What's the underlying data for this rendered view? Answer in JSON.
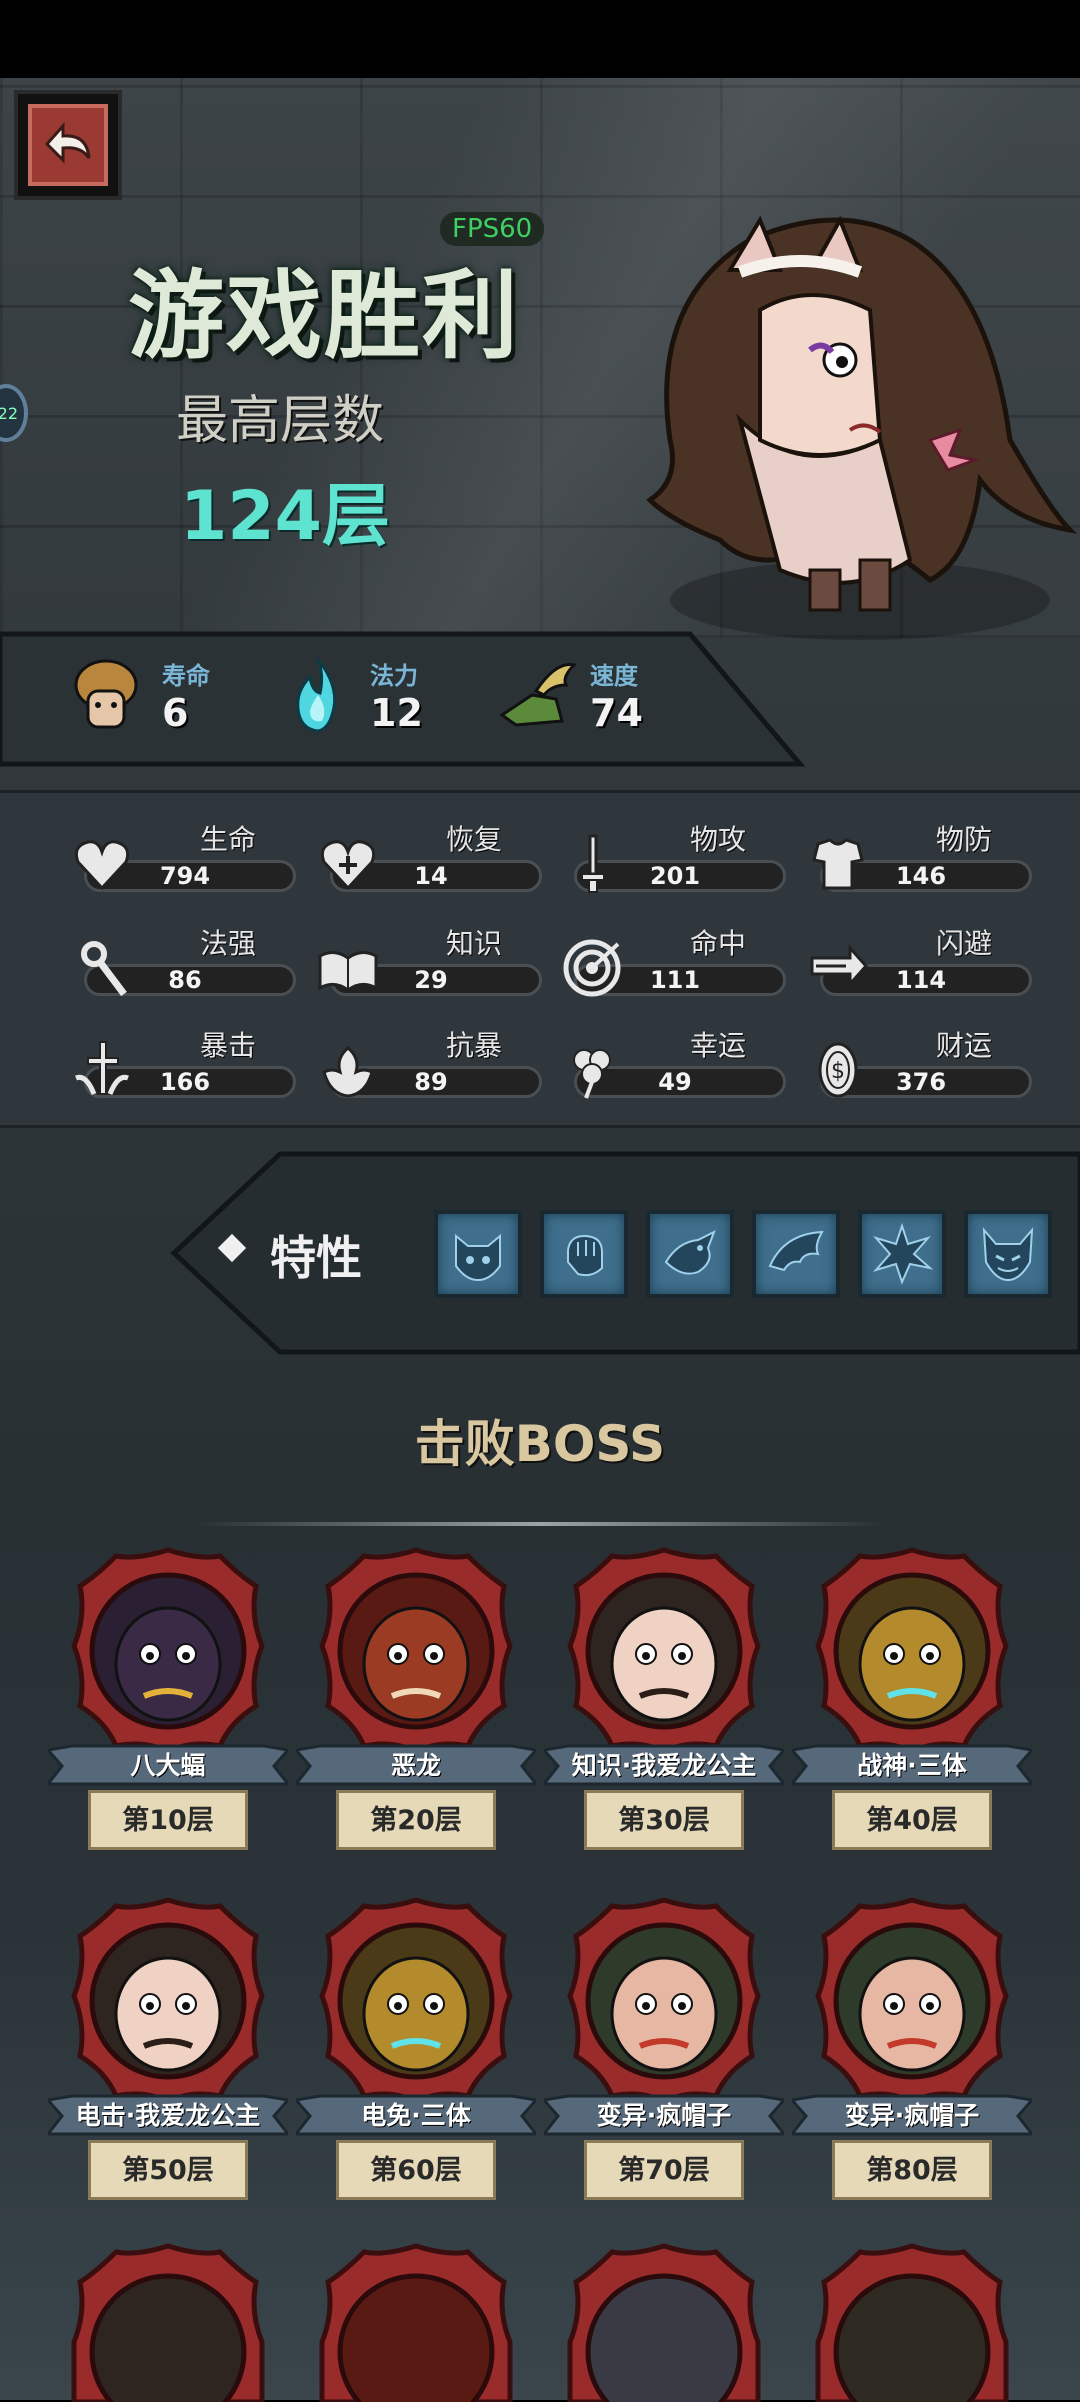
{
  "header": {
    "fps": "FPS60",
    "title": "游戏胜利",
    "max_floor_label": "最高层数",
    "max_floor_value": "124层",
    "side_badge": "22"
  },
  "top_stats": [
    {
      "label": "寿命",
      "value": "6",
      "icon": "mushroom-head-icon"
    },
    {
      "label": "法力",
      "value": "12",
      "icon": "blue-flame-icon"
    },
    {
      "label": "速度",
      "value": "74",
      "icon": "winged-boot-icon"
    }
  ],
  "attributes": [
    {
      "label": "生命",
      "value": "794",
      "icon": "heart-icon"
    },
    {
      "label": "恢复",
      "value": "14",
      "icon": "heal-heart-icon"
    },
    {
      "label": "物攻",
      "value": "201",
      "icon": "sword-icon"
    },
    {
      "label": "物防",
      "value": "146",
      "icon": "armor-icon"
    },
    {
      "label": "法强",
      "value": "86",
      "icon": "magic-staff-icon"
    },
    {
      "label": "知识",
      "value": "29",
      "icon": "book-icon"
    },
    {
      "label": "命中",
      "value": "111",
      "icon": "target-icon"
    },
    {
      "label": "闪避",
      "value": "114",
      "icon": "dodge-arrow-icon"
    },
    {
      "label": "暴击",
      "value": "166",
      "icon": "critical-icon"
    },
    {
      "label": "抗暴",
      "value": "89",
      "icon": "crit-resist-icon"
    },
    {
      "label": "幸运",
      "value": "49",
      "icon": "clover-icon"
    },
    {
      "label": "财运",
      "value": "376",
      "icon": "coin-icon"
    }
  ],
  "traits": {
    "title": "特性",
    "icons": [
      "cat-face-icon",
      "fist-icon",
      "dragon-icon",
      "wing-icon",
      "spike-burst-icon",
      "demon-face-icon"
    ]
  },
  "bosses": {
    "title": "击败BOSS",
    "items": [
      {
        "name": "八大蝠",
        "floor": "第10层",
        "palette": "purple"
      },
      {
        "name": "恶龙",
        "floor": "第20层",
        "palette": "dragon"
      },
      {
        "name": "知识·我爱龙公主",
        "floor": "第30层",
        "palette": "princess"
      },
      {
        "name": "战神·三体",
        "floor": "第40层",
        "palette": "golem"
      },
      {
        "name": "电击·我爱龙公主",
        "floor": "第50层",
        "palette": "princess"
      },
      {
        "name": "电免·三体",
        "floor": "第60层",
        "palette": "golem"
      },
      {
        "name": "变异·疯帽子",
        "floor": "第70层",
        "palette": "hatter"
      },
      {
        "name": "变异·疯帽子",
        "floor": "第80层",
        "palette": "hatter"
      }
    ]
  },
  "colors": {
    "accent_cyan": "#5ee3d0",
    "boss_frame_red": "#9a2b2b",
    "nameplate_blue": "#56697a"
  }
}
